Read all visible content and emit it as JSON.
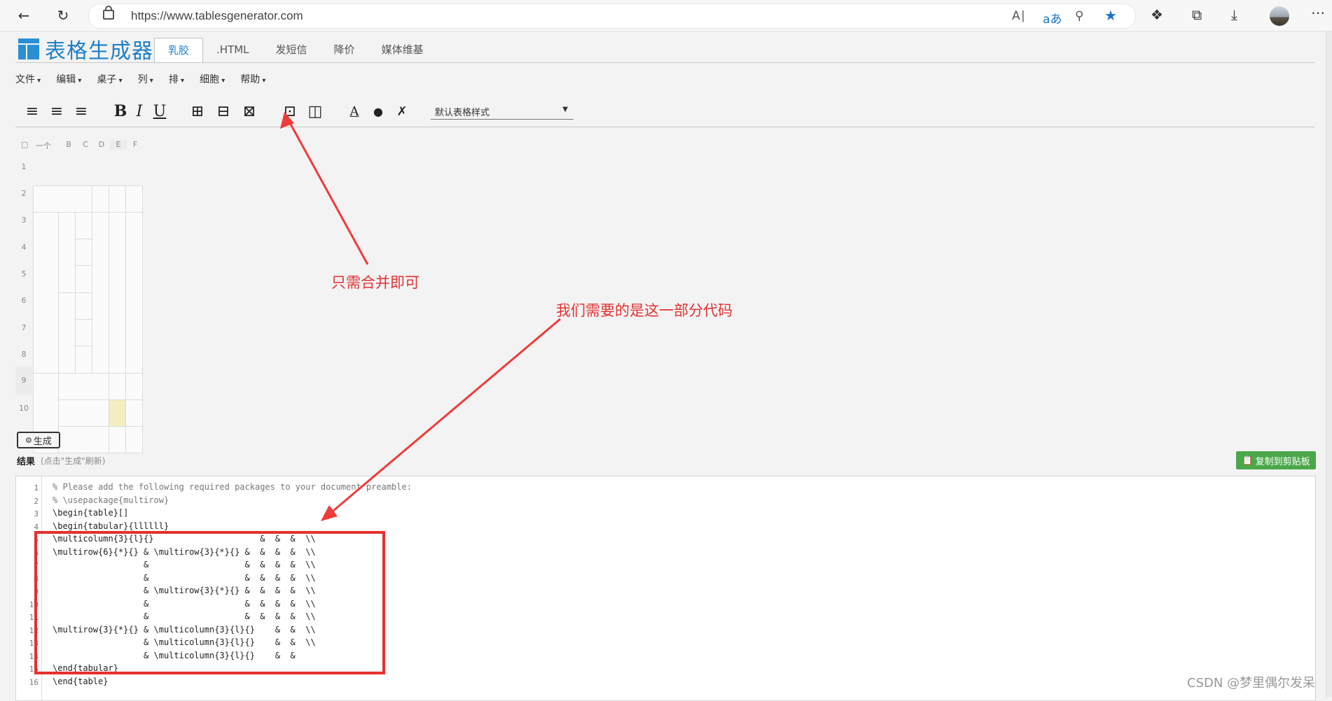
{
  "browser": {
    "url": "https://www.tablesgenerator.com",
    "icons": [
      "back-icon",
      "refresh-icon",
      "lock-icon",
      "read-aloud-icon",
      "translate-icon",
      "zoom-icon",
      "favorite-star-icon",
      "extensions-icon",
      "collections-icon",
      "download-icon",
      "profile-avatar",
      "more-icon"
    ]
  },
  "header": {
    "logo_text": "表格生成器",
    "tabs": [
      "乳胶",
      ".HTML",
      "发短信",
      "降价",
      "媒体维基"
    ]
  },
  "menu": [
    "文件",
    "编辑",
    "桌子",
    "列",
    "排",
    "细胞",
    "帮助"
  ],
  "toolbar": {
    "bold": "B",
    "italic": "I",
    "underline": "U",
    "text_color": "A",
    "table_style": "默认表格样式"
  },
  "grid": {
    "columns": [
      "一个",
      "B",
      "C",
      "D",
      "E",
      "F"
    ],
    "rows": [
      "1",
      "2",
      "3",
      "4",
      "5",
      "6",
      "7",
      "8",
      "9",
      "10"
    ],
    "highlight_color": "#f3edc0"
  },
  "actions": {
    "generate": "生成",
    "result_label": "结果",
    "result_hint": "(点击\"生成\"刷新)",
    "copy": "复制到剪贴板"
  },
  "code": {
    "line_numbers": [
      "1",
      "2",
      "3",
      "4",
      "5",
      "6",
      "7",
      "8",
      "9",
      "10",
      "11",
      "12",
      "13",
      "14",
      "15",
      "16"
    ],
    "lines": [
      "% Please add the following required packages to your document preamble:",
      "% \\usepackage{multirow}",
      "\\begin{table}[]",
      "\\begin{tabular}{llllll}",
      "\\multicolumn{3}{l}{}                     &  &  &  \\\\",
      "\\multirow{6}{*}{} & \\multirow{3}{*}{} &  &  &  &  \\\\",
      "                  &                   &  &  &  &  \\\\",
      "                  &                   &  &  &  &  \\\\",
      "                  & \\multirow{3}{*}{} &  &  &  &  \\\\",
      "                  &                   &  &  &  &  \\\\",
      "                  &                   &  &  &  &  \\\\",
      "\\multirow{3}{*}{} & \\multicolumn{3}{l}{}    &  &  \\\\",
      "                  & \\multicolumn{3}{l}{}    &  &  \\\\",
      "                  & \\multicolumn{3}{l}{}    &  &",
      "\\end{tabular}",
      "\\end{table}"
    ]
  },
  "annotations": {
    "merge_note": "只需合并即可",
    "code_note": "我们需要的是这一部分代码",
    "color": "#e23232"
  },
  "watermark": "CSDN @梦里偶尔发呆"
}
